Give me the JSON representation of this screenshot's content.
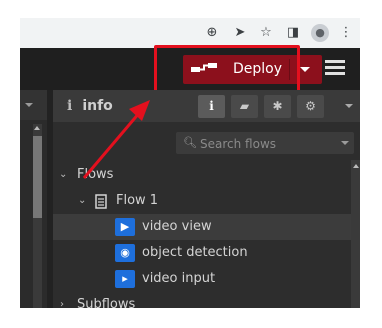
{
  "browser": {
    "icons": [
      "zoom-icon",
      "send-icon",
      "star-icon",
      "sidebar-icon",
      "profile-icon",
      "more-icon"
    ]
  },
  "header": {
    "deploy_label": "Deploy",
    "menu_icon": "hamburger-icon"
  },
  "sidebar": {
    "title": "info",
    "tabs": [
      "info",
      "help",
      "debug",
      "config"
    ],
    "search": {
      "placeholder": "Search flows",
      "value": ""
    },
    "tree": {
      "flows_label": "Flows",
      "flow1_label": "Flow 1",
      "nodes": [
        {
          "label": "video view",
          "icon": "video-view-icon"
        },
        {
          "label": "object detection",
          "icon": "object-detection-icon"
        },
        {
          "label": "video input",
          "icon": "video-input-icon"
        }
      ],
      "subflows_label": "Subflows"
    }
  },
  "colors": {
    "deploy_bg": "#8c101c",
    "highlight": "#e3101e",
    "node_icon_bg": "#1e6fdc",
    "header_bg": "#1f1f1f",
    "sidebar_bg": "#2d2d2d"
  }
}
